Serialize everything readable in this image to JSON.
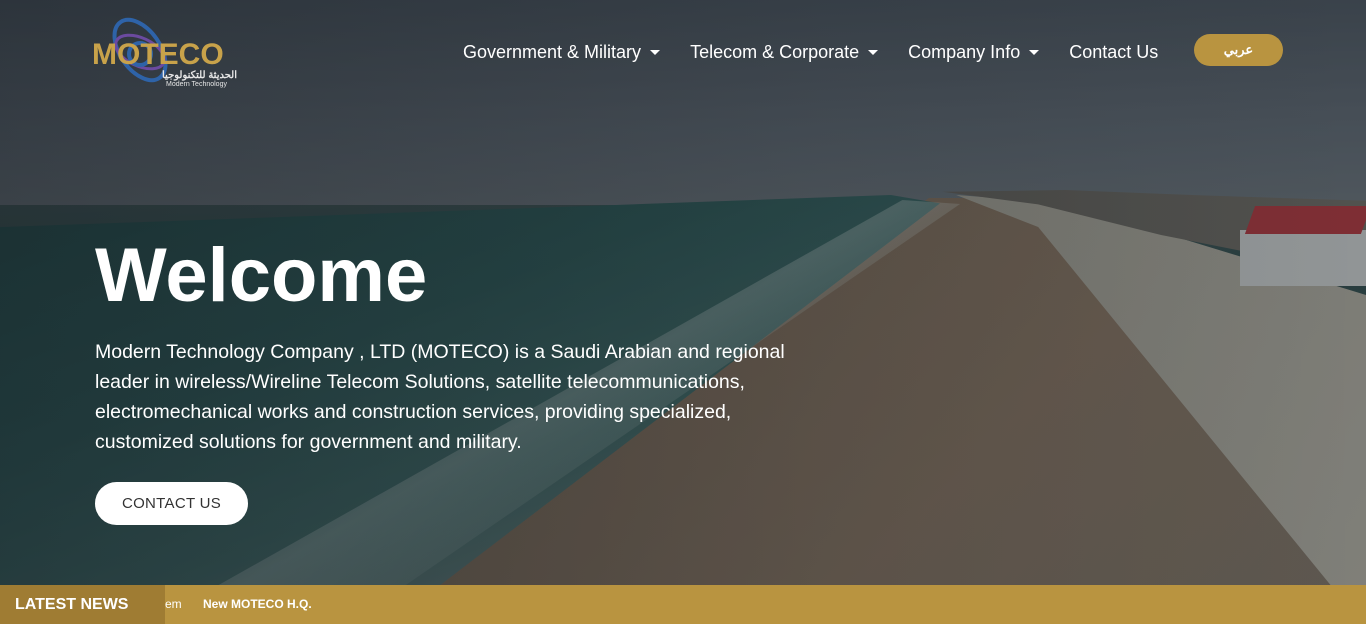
{
  "brand": {
    "name": "MOTECO",
    "arabic_name": "الحديثة للتكنولوجيا",
    "subtitle": "Modern Technology"
  },
  "nav": {
    "items": [
      {
        "label": "Government & Military",
        "has_dropdown": true
      },
      {
        "label": "Telecom & Corporate",
        "has_dropdown": true
      },
      {
        "label": "Company Info",
        "has_dropdown": true
      },
      {
        "label": "Contact Us",
        "has_dropdown": false
      }
    ],
    "language_button": "عربي"
  },
  "hero": {
    "title": "Welcome",
    "description": "Modern Technology Company , LTD (MOTECO) is a Saudi Arabian and regional leader in wireless/Wireline Telecom Solutions, satellite telecommunications, electromechanical works and construction services, providing specialized, customized solutions for government and military.",
    "cta_label": "CONTACT US"
  },
  "news": {
    "label": "LATEST NEWS",
    "partial_item": "em",
    "item": "New MOTECO H.Q."
  },
  "colors": {
    "accent": "#b99440",
    "accent_dark": "#9f7c33",
    "logo_gold": "#c8a24a",
    "logo_blue": "#2e63a8"
  }
}
